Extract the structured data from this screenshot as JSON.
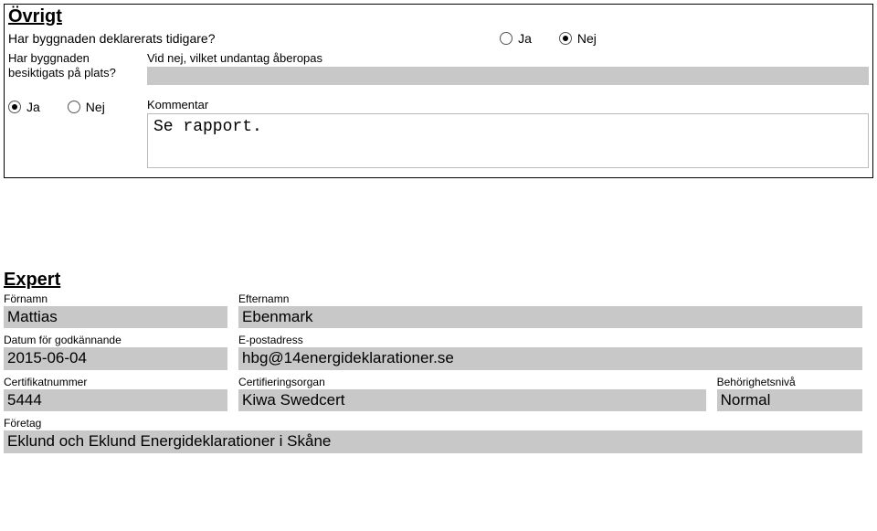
{
  "ovrigt": {
    "title": "Övrigt",
    "q1": {
      "label": "Har byggnaden deklarerats tidigare?",
      "ja": "Ja",
      "nej": "Nej"
    },
    "q2": {
      "left1": "Har byggnaden",
      "left2": "besiktigats på plats?",
      "right_label": "Vid nej, vilket undantag åberopas",
      "value": ""
    },
    "q3": {
      "ja": "Ja",
      "nej": "Nej",
      "comment_label": "Kommentar",
      "comment_value": "Se rapport."
    }
  },
  "expert": {
    "title": "Expert",
    "fornamn_label": "Förnamn",
    "fornamn_value": "Mattias",
    "efternamn_label": "Efternamn",
    "efternamn_value": "Ebenmark",
    "datum_label": "Datum för godkännande",
    "datum_value": "2015-06-04",
    "epost_label": "E-postadress",
    "epost_value": "hbg@14energideklarationer.se",
    "cert_label": "Certifikatnummer",
    "cert_value": "5444",
    "organ_label": "Certifieringsorgan",
    "organ_value": "Kiwa Swedcert",
    "niva_label": "Behörighetsnivå",
    "niva_value": "Normal",
    "foretag_label": "Företag",
    "foretag_value": "Eklund och Eklund Energideklarationer i Skåne"
  }
}
